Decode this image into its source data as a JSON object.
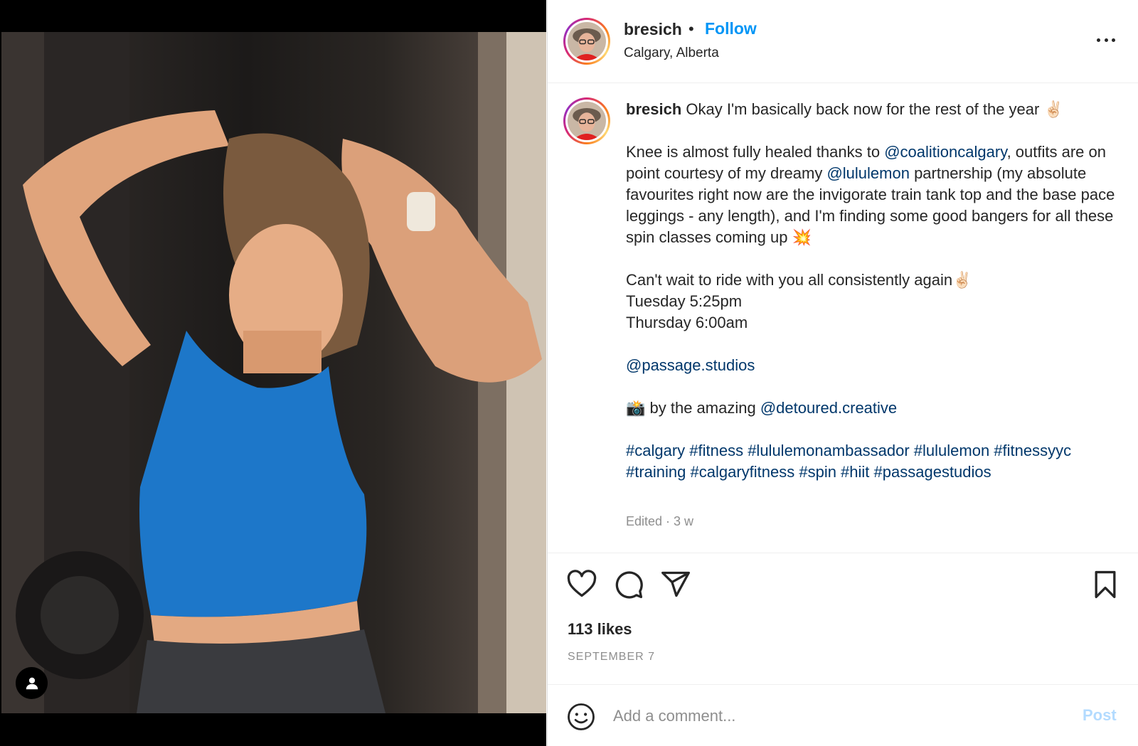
{
  "post": {
    "username": "bresich",
    "separator": "•",
    "follow_label": "Follow",
    "location": "Calgary, Alberta",
    "more_icon": "more-horizontal-icon"
  },
  "caption": {
    "username": "bresich",
    "line1": "Okay I'm basically back now for the rest of the year ✌🏻",
    "p2_a": "Knee is almost fully healed thanks to ",
    "p2_link1": "@coalitioncalgary",
    "p2_b": ", outfits are on point courtesy of my dreamy ",
    "p2_link2": "@lululemon",
    "p2_c": " partnership (my absolute favourites right now are the invigorate train tank top and the base pace leggings - any length), and I'm finding some good bangers for all these spin classes coming up 💥",
    "p3_line1": "Can't wait to ride with you all consistently again✌🏻",
    "p3_line2": "Tuesday 5:25pm",
    "p3_line3": "Thursday 6:00am",
    "p4_link": "@passage.studios",
    "p5_a": "📸 by the amazing ",
    "p5_link": "@detoured.creative",
    "hashtags": "#calgary #fitness #lululemonambassador #lululemon #fitnessyyc #training #calgaryfitness #spin #hiit #passagestudios",
    "meta": "Edited · 3 w"
  },
  "actions": {
    "likes": "113 likes",
    "date": "SEPTEMBER 7",
    "icons": [
      "heart-icon",
      "comment-icon",
      "share-icon",
      "bookmark-icon"
    ]
  },
  "comment": {
    "placeholder": "Add a comment...",
    "post_label": "Post"
  },
  "colors": {
    "link": "#00376b",
    "follow": "#0095f6",
    "post_disabled": "#b3dbff",
    "muted": "#8e8e8e",
    "tank_top": "#1d77c9"
  }
}
